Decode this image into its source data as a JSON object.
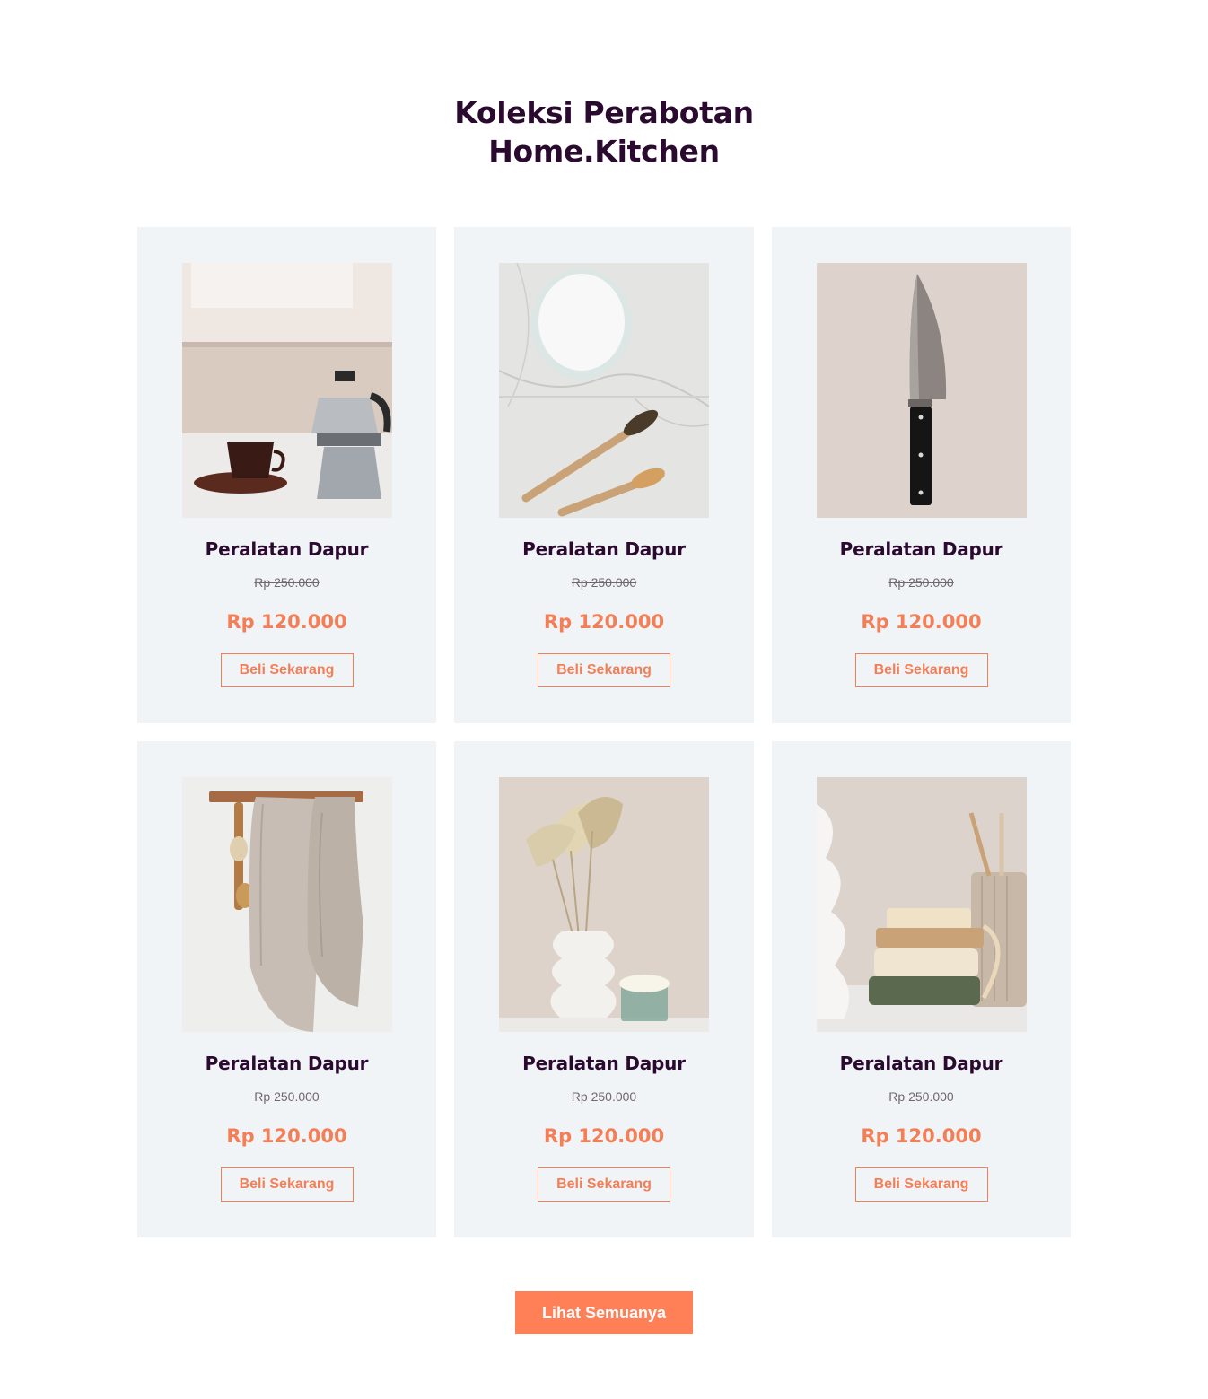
{
  "header": {
    "title_line1": "Koleksi Perabotan",
    "title_line2": "Home.Kitchen"
  },
  "products": [
    {
      "image": "coffee-moka-pot-image",
      "name": "Peralatan Dapur",
      "old_price": "Rp 250.000",
      "price": "Rp 120.000",
      "button": "Beli Sekarang"
    },
    {
      "image": "bamboo-toothbrush-image",
      "name": "Peralatan Dapur",
      "old_price": "Rp 250.000",
      "price": "Rp 120.000",
      "button": "Beli Sekarang"
    },
    {
      "image": "chef-knife-image",
      "name": "Peralatan Dapur",
      "old_price": "Rp 250.000",
      "price": "Rp 120.000",
      "button": "Beli Sekarang"
    },
    {
      "image": "hanging-towels-image",
      "name": "Peralatan Dapur",
      "old_price": "Rp 250.000",
      "price": "Rp 120.000",
      "button": "Beli Sekarang"
    },
    {
      "image": "dried-palm-vase-image",
      "name": "Peralatan Dapur",
      "old_price": "Rp 250.000",
      "price": "Rp 120.000",
      "button": "Beli Sekarang"
    },
    {
      "image": "soap-brush-image",
      "name": "Peralatan Dapur",
      "old_price": "Rp 250.000",
      "price": "Rp 120.000",
      "button": "Beli Sekarang"
    }
  ],
  "footer": {
    "see_all_label": "Lihat Semuanya"
  },
  "colors": {
    "heading": "#2b0a2f",
    "accent": "#f47f56",
    "card_bg": "#f1f4f7",
    "button_bg": "#ff7f57"
  }
}
